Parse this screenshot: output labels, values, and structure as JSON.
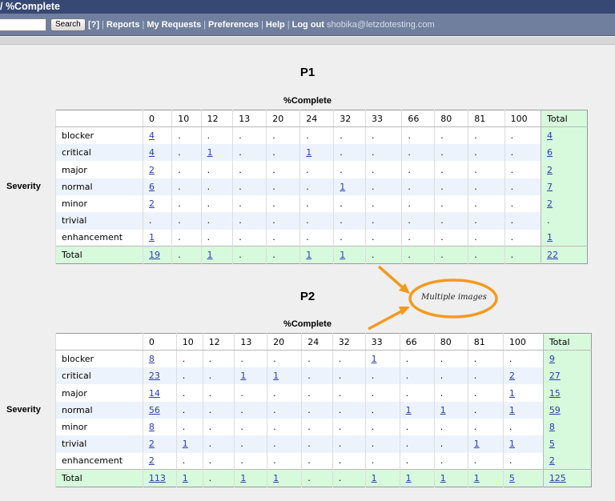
{
  "titlebar": {
    "title": "/ %Complete"
  },
  "nav": {
    "search_button": "Search",
    "help_short": "[?]",
    "links": [
      "Reports",
      "My Requests",
      "Preferences",
      "Help",
      "Log out"
    ],
    "separator": "|",
    "user_email": "shobika@letzdotesting.com"
  },
  "reports": [
    {
      "title": "P1",
      "column_header": "%Complete",
      "row_header": "Severity",
      "columns": [
        "0",
        "10",
        "12",
        "13",
        "20",
        "24",
        "32",
        "33",
        "66",
        "80",
        "81",
        "100",
        "Total"
      ],
      "rows": [
        {
          "label": "blocker",
          "cells": [
            "4",
            ".",
            ".",
            ".",
            ".",
            ".",
            ".",
            ".",
            ".",
            ".",
            ".",
            ".",
            "4"
          ]
        },
        {
          "label": "critical",
          "cells": [
            "4",
            ".",
            "1",
            ".",
            ".",
            "1",
            ".",
            ".",
            ".",
            ".",
            ".",
            ".",
            "6"
          ]
        },
        {
          "label": "major",
          "cells": [
            "2",
            ".",
            ".",
            ".",
            ".",
            ".",
            ".",
            ".",
            ".",
            ".",
            ".",
            ".",
            "2"
          ]
        },
        {
          "label": "normal",
          "cells": [
            "6",
            ".",
            ".",
            ".",
            ".",
            ".",
            "1",
            ".",
            ".",
            ".",
            ".",
            ".",
            "7"
          ]
        },
        {
          "label": "minor",
          "cells": [
            "2",
            ".",
            ".",
            ".",
            ".",
            ".",
            ".",
            ".",
            ".",
            ".",
            ".",
            ".",
            "2"
          ]
        },
        {
          "label": "trivial",
          "cells": [
            ".",
            ".",
            ".",
            ".",
            ".",
            ".",
            ".",
            ".",
            ".",
            ".",
            ".",
            ".",
            "."
          ]
        },
        {
          "label": "enhancement",
          "cells": [
            "1",
            ".",
            ".",
            ".",
            ".",
            ".",
            ".",
            ".",
            ".",
            ".",
            ".",
            ".",
            "1"
          ]
        },
        {
          "label": "Total",
          "cells": [
            "19",
            ".",
            "1",
            ".",
            ".",
            "1",
            "1",
            ".",
            ".",
            ".",
            ".",
            ".",
            "22"
          ]
        }
      ]
    },
    {
      "title": "P2",
      "column_header": "%Complete",
      "row_header": "Severity",
      "columns": [
        "0",
        "10",
        "12",
        "13",
        "20",
        "24",
        "32",
        "33",
        "66",
        "80",
        "81",
        "100",
        "Total"
      ],
      "rows": [
        {
          "label": "blocker",
          "cells": [
            "8",
            ".",
            ".",
            ".",
            ".",
            ".",
            ".",
            "1",
            ".",
            ".",
            ".",
            ".",
            "9"
          ]
        },
        {
          "label": "critical",
          "cells": [
            "23",
            ".",
            ".",
            "1",
            "1",
            ".",
            ".",
            ".",
            ".",
            ".",
            ".",
            "2",
            "27"
          ]
        },
        {
          "label": "major",
          "cells": [
            "14",
            ".",
            ".",
            ".",
            ".",
            ".",
            ".",
            ".",
            ".",
            ".",
            ".",
            "1",
            "15"
          ]
        },
        {
          "label": "normal",
          "cells": [
            "56",
            ".",
            ".",
            ".",
            ".",
            ".",
            ".",
            ".",
            "1",
            "1",
            ".",
            "1",
            "59"
          ]
        },
        {
          "label": "minor",
          "cells": [
            "8",
            ".",
            ".",
            ".",
            ".",
            ".",
            ".",
            ".",
            ".",
            ".",
            ".",
            ".",
            "8"
          ]
        },
        {
          "label": "trivial",
          "cells": [
            "2",
            "1",
            ".",
            ".",
            ".",
            ".",
            ".",
            ".",
            ".",
            ".",
            "1",
            "1",
            "5"
          ]
        },
        {
          "label": "enhancement",
          "cells": [
            "2",
            ".",
            ".",
            ".",
            ".",
            ".",
            ".",
            ".",
            ".",
            ".",
            ".",
            ".",
            "2"
          ]
        },
        {
          "label": "Total",
          "cells": [
            "113",
            "1",
            ".",
            "1",
            "1",
            ".",
            ".",
            "1",
            "1",
            "1",
            "1",
            "5",
            "125"
          ]
        }
      ]
    }
  ],
  "annotation": {
    "text": "Multiple images",
    "color": "#f39a1e"
  },
  "colors": {
    "link": "#2b3cb0",
    "total_bg": "#d7fadc",
    "alt_row": "#edf3fd",
    "titlebar": "#384874",
    "navbar": "#6f7f9d"
  }
}
